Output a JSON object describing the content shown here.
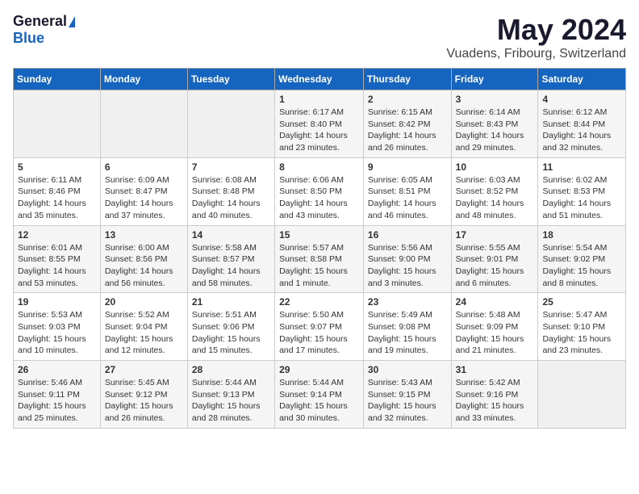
{
  "logo": {
    "general": "General",
    "blue": "Blue"
  },
  "title": "May 2024",
  "subtitle": "Vuadens, Fribourg, Switzerland",
  "days_header": [
    "Sunday",
    "Monday",
    "Tuesday",
    "Wednesday",
    "Thursday",
    "Friday",
    "Saturday"
  ],
  "weeks": [
    [
      {
        "day": "",
        "info": ""
      },
      {
        "day": "",
        "info": ""
      },
      {
        "day": "",
        "info": ""
      },
      {
        "day": "1",
        "info": "Sunrise: 6:17 AM\nSunset: 8:40 PM\nDaylight: 14 hours\nand 23 minutes."
      },
      {
        "day": "2",
        "info": "Sunrise: 6:15 AM\nSunset: 8:42 PM\nDaylight: 14 hours\nand 26 minutes."
      },
      {
        "day": "3",
        "info": "Sunrise: 6:14 AM\nSunset: 8:43 PM\nDaylight: 14 hours\nand 29 minutes."
      },
      {
        "day": "4",
        "info": "Sunrise: 6:12 AM\nSunset: 8:44 PM\nDaylight: 14 hours\nand 32 minutes."
      }
    ],
    [
      {
        "day": "5",
        "info": "Sunrise: 6:11 AM\nSunset: 8:46 PM\nDaylight: 14 hours\nand 35 minutes."
      },
      {
        "day": "6",
        "info": "Sunrise: 6:09 AM\nSunset: 8:47 PM\nDaylight: 14 hours\nand 37 minutes."
      },
      {
        "day": "7",
        "info": "Sunrise: 6:08 AM\nSunset: 8:48 PM\nDaylight: 14 hours\nand 40 minutes."
      },
      {
        "day": "8",
        "info": "Sunrise: 6:06 AM\nSunset: 8:50 PM\nDaylight: 14 hours\nand 43 minutes."
      },
      {
        "day": "9",
        "info": "Sunrise: 6:05 AM\nSunset: 8:51 PM\nDaylight: 14 hours\nand 46 minutes."
      },
      {
        "day": "10",
        "info": "Sunrise: 6:03 AM\nSunset: 8:52 PM\nDaylight: 14 hours\nand 48 minutes."
      },
      {
        "day": "11",
        "info": "Sunrise: 6:02 AM\nSunset: 8:53 PM\nDaylight: 14 hours\nand 51 minutes."
      }
    ],
    [
      {
        "day": "12",
        "info": "Sunrise: 6:01 AM\nSunset: 8:55 PM\nDaylight: 14 hours\nand 53 minutes."
      },
      {
        "day": "13",
        "info": "Sunrise: 6:00 AM\nSunset: 8:56 PM\nDaylight: 14 hours\nand 56 minutes."
      },
      {
        "day": "14",
        "info": "Sunrise: 5:58 AM\nSunset: 8:57 PM\nDaylight: 14 hours\nand 58 minutes."
      },
      {
        "day": "15",
        "info": "Sunrise: 5:57 AM\nSunset: 8:58 PM\nDaylight: 15 hours\nand 1 minute."
      },
      {
        "day": "16",
        "info": "Sunrise: 5:56 AM\nSunset: 9:00 PM\nDaylight: 15 hours\nand 3 minutes."
      },
      {
        "day": "17",
        "info": "Sunrise: 5:55 AM\nSunset: 9:01 PM\nDaylight: 15 hours\nand 6 minutes."
      },
      {
        "day": "18",
        "info": "Sunrise: 5:54 AM\nSunset: 9:02 PM\nDaylight: 15 hours\nand 8 minutes."
      }
    ],
    [
      {
        "day": "19",
        "info": "Sunrise: 5:53 AM\nSunset: 9:03 PM\nDaylight: 15 hours\nand 10 minutes."
      },
      {
        "day": "20",
        "info": "Sunrise: 5:52 AM\nSunset: 9:04 PM\nDaylight: 15 hours\nand 12 minutes."
      },
      {
        "day": "21",
        "info": "Sunrise: 5:51 AM\nSunset: 9:06 PM\nDaylight: 15 hours\nand 15 minutes."
      },
      {
        "day": "22",
        "info": "Sunrise: 5:50 AM\nSunset: 9:07 PM\nDaylight: 15 hours\nand 17 minutes."
      },
      {
        "day": "23",
        "info": "Sunrise: 5:49 AM\nSunset: 9:08 PM\nDaylight: 15 hours\nand 19 minutes."
      },
      {
        "day": "24",
        "info": "Sunrise: 5:48 AM\nSunset: 9:09 PM\nDaylight: 15 hours\nand 21 minutes."
      },
      {
        "day": "25",
        "info": "Sunrise: 5:47 AM\nSunset: 9:10 PM\nDaylight: 15 hours\nand 23 minutes."
      }
    ],
    [
      {
        "day": "26",
        "info": "Sunrise: 5:46 AM\nSunset: 9:11 PM\nDaylight: 15 hours\nand 25 minutes."
      },
      {
        "day": "27",
        "info": "Sunrise: 5:45 AM\nSunset: 9:12 PM\nDaylight: 15 hours\nand 26 minutes."
      },
      {
        "day": "28",
        "info": "Sunrise: 5:44 AM\nSunset: 9:13 PM\nDaylight: 15 hours\nand 28 minutes."
      },
      {
        "day": "29",
        "info": "Sunrise: 5:44 AM\nSunset: 9:14 PM\nDaylight: 15 hours\nand 30 minutes."
      },
      {
        "day": "30",
        "info": "Sunrise: 5:43 AM\nSunset: 9:15 PM\nDaylight: 15 hours\nand 32 minutes."
      },
      {
        "day": "31",
        "info": "Sunrise: 5:42 AM\nSunset: 9:16 PM\nDaylight: 15 hours\nand 33 minutes."
      },
      {
        "day": "",
        "info": ""
      }
    ]
  ]
}
